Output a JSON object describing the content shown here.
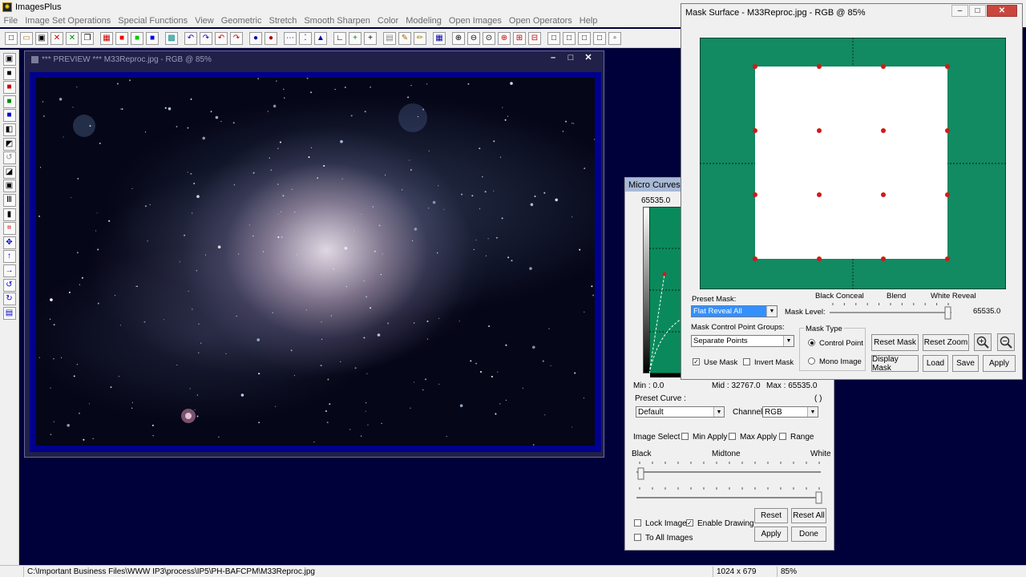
{
  "app": {
    "title": "ImagesPlus",
    "icon": "imagesplus-logo-icon"
  },
  "menu": [
    "File",
    "Image Set Operations",
    "Special Functions",
    "View",
    "Geometric",
    "Stretch",
    "Smooth Sharpen",
    "Color",
    "Modeling",
    "Open Images",
    "Open Operators",
    "Help"
  ],
  "toolbar": {
    "icons": [
      "new-file-icon",
      "open-folder-icon",
      "save-icon",
      "close-red-icon",
      "close-green-icon",
      "copy-icon",
      "rgb-icon",
      "red-square-icon",
      "green-square-icon",
      "blue-square-icon",
      "grid-icon",
      "undo-icon",
      "redo-icon",
      "undo-red-icon",
      "redo-red-icon",
      "record-icon",
      "stop-record-icon",
      "dots-icon",
      "xy-icon",
      "triangle-icon",
      "axes-icon",
      "plus-green-icon",
      "crosshair-icon",
      "table-icon",
      "paint-icon",
      "pencil-icon",
      "matrix-icon",
      "zoom-in-icon",
      "zoom-out-icon",
      "zoom-fit-icon",
      "zoom-red-icon",
      "zoom-plus-icon",
      "zoom-minus-icon",
      "square-icon",
      "square-2-icon",
      "square-3-icon",
      "square-4-icon",
      "square-5-icon"
    ]
  },
  "left_toolbar": {
    "icons": [
      "save-icon",
      "black-square-icon",
      "red-black-icon",
      "green-black-icon",
      "blue-black-icon",
      "split-icon",
      "stack-icon",
      "brush-icon",
      "levels-icon",
      "frame-icon",
      "bars-icon",
      "black-rect-icon",
      "crop-icon",
      "move-icon",
      "arrow-up-icon",
      "arrow-right-icon",
      "rotate-left-icon",
      "rotate-right-icon",
      "info-icon"
    ]
  },
  "preview_window": {
    "title": "*** PREVIEW *** M33Reproc.jpg - RGB @ 85%",
    "buttons": [
      "–",
      "□",
      "✕"
    ]
  },
  "micro_curves": {
    "title": "Micro Curves - ",
    "top_value": "65535.0",
    "min_label": "Min : 0.0",
    "mid_label": "Mid : 32767.0",
    "max_label": "Max : 65535.0",
    "preset_curve_label": "Preset Curve :",
    "paren_label": "( )",
    "preset_curve_value": "Default",
    "channel_label": "Channel:",
    "channel_value": "RGB",
    "image_select_label": "Image Select",
    "min_apply_label": "Min Apply",
    "max_apply_label": "Max Apply",
    "range_label": "Range",
    "black_label": "Black",
    "midtone_label": "Midtone",
    "white_label": "White",
    "lock_image_label": "Lock Image",
    "enable_drawing_label": "Enable Drawing",
    "to_all_images_label": "To All Images",
    "reset_label": "Reset",
    "reset_all_label": "Reset All",
    "apply_label": "Apply",
    "done_label": "Done",
    "enable_drawing_checked": true,
    "curve_color": "#0a8a5c"
  },
  "mask_surface": {
    "title": "Mask Surface - M33Reproc.jpg - RGB @ 85%",
    "window_buttons": [
      "–",
      "□",
      "✕"
    ],
    "preset_mask_label": "Preset Mask:",
    "preset_mask_value": "Flat Reveal All",
    "black_conceal_label": "Black Conceal",
    "blend_label": "Blend",
    "white_reveal_label": "White Reveal",
    "mask_level_label": "Mask Level:",
    "mask_level_value": "65535.0",
    "mask_level_fraction": 1.0,
    "control_point_groups_label": "Mask Control Point Groups:",
    "control_point_groups_value": "Separate Points",
    "mask_type_label": "Mask Type",
    "control_point_label": "Control Point",
    "mono_image_label": "Mono Image",
    "use_mask_label": "Use Mask",
    "invert_mask_label": "Invert Mask",
    "use_mask_checked": true,
    "reset_mask_label": "Reset Mask",
    "reset_zoom_label": "Reset Zoom",
    "display_mask_label": "Display Mask",
    "load_label": "Load",
    "save_label": "Save",
    "apply_label": "Apply",
    "zoom_in_icon": "zoom-in-icon",
    "zoom_out_icon": "zoom-out-icon",
    "surface_color": "#128a62",
    "reveal_color": "#ffffff",
    "point_color": "#d01a1a"
  },
  "statusbar": {
    "path": "C:\\Important Business Files\\WWW IP3\\process\\IP5\\PH-BAFCPM\\M33Reproc.jpg",
    "dimensions": "1024 x 679",
    "zoom": "85%"
  }
}
